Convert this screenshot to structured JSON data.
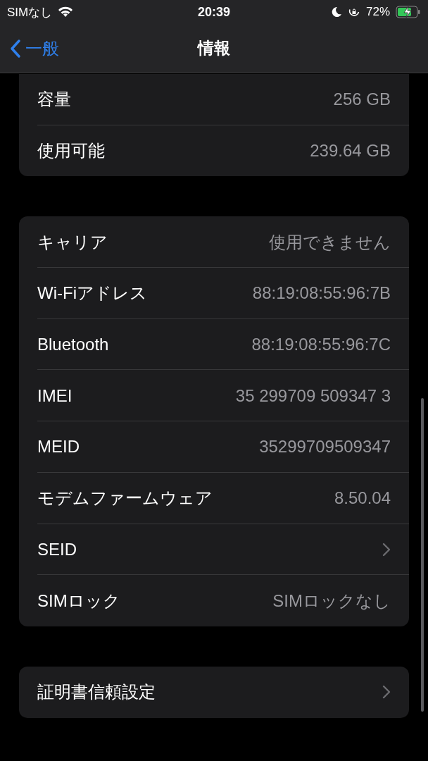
{
  "status_bar": {
    "carrier": "SIMなし",
    "time": "20:39",
    "battery": "72%"
  },
  "nav": {
    "back": "一般",
    "title": "情報"
  },
  "groups": [
    {
      "rows": [
        {
          "kind": "value",
          "label": "容量",
          "value": "256 GB"
        },
        {
          "kind": "value",
          "label": "使用可能",
          "value": "239.64 GB"
        }
      ]
    },
    {
      "rows": [
        {
          "kind": "value",
          "label": "キャリア",
          "value": "使用できません"
        },
        {
          "kind": "value",
          "label": "Wi-Fiアドレス",
          "value": "88:19:08:55:96:7B"
        },
        {
          "kind": "value",
          "label": "Bluetooth",
          "value": "88:19:08:55:96:7C"
        },
        {
          "kind": "value",
          "label": "IMEI",
          "value": "35 299709 509347 3"
        },
        {
          "kind": "value",
          "label": "MEID",
          "value": "35299709509347"
        },
        {
          "kind": "value",
          "label": "モデムファームウェア",
          "value": "8.50.04"
        },
        {
          "kind": "link",
          "label": "SEID"
        },
        {
          "kind": "value",
          "label": "SIMロック",
          "value": "SIMロックなし"
        }
      ]
    },
    {
      "rows": [
        {
          "kind": "link",
          "label": "証明書信頼設定"
        }
      ]
    }
  ]
}
